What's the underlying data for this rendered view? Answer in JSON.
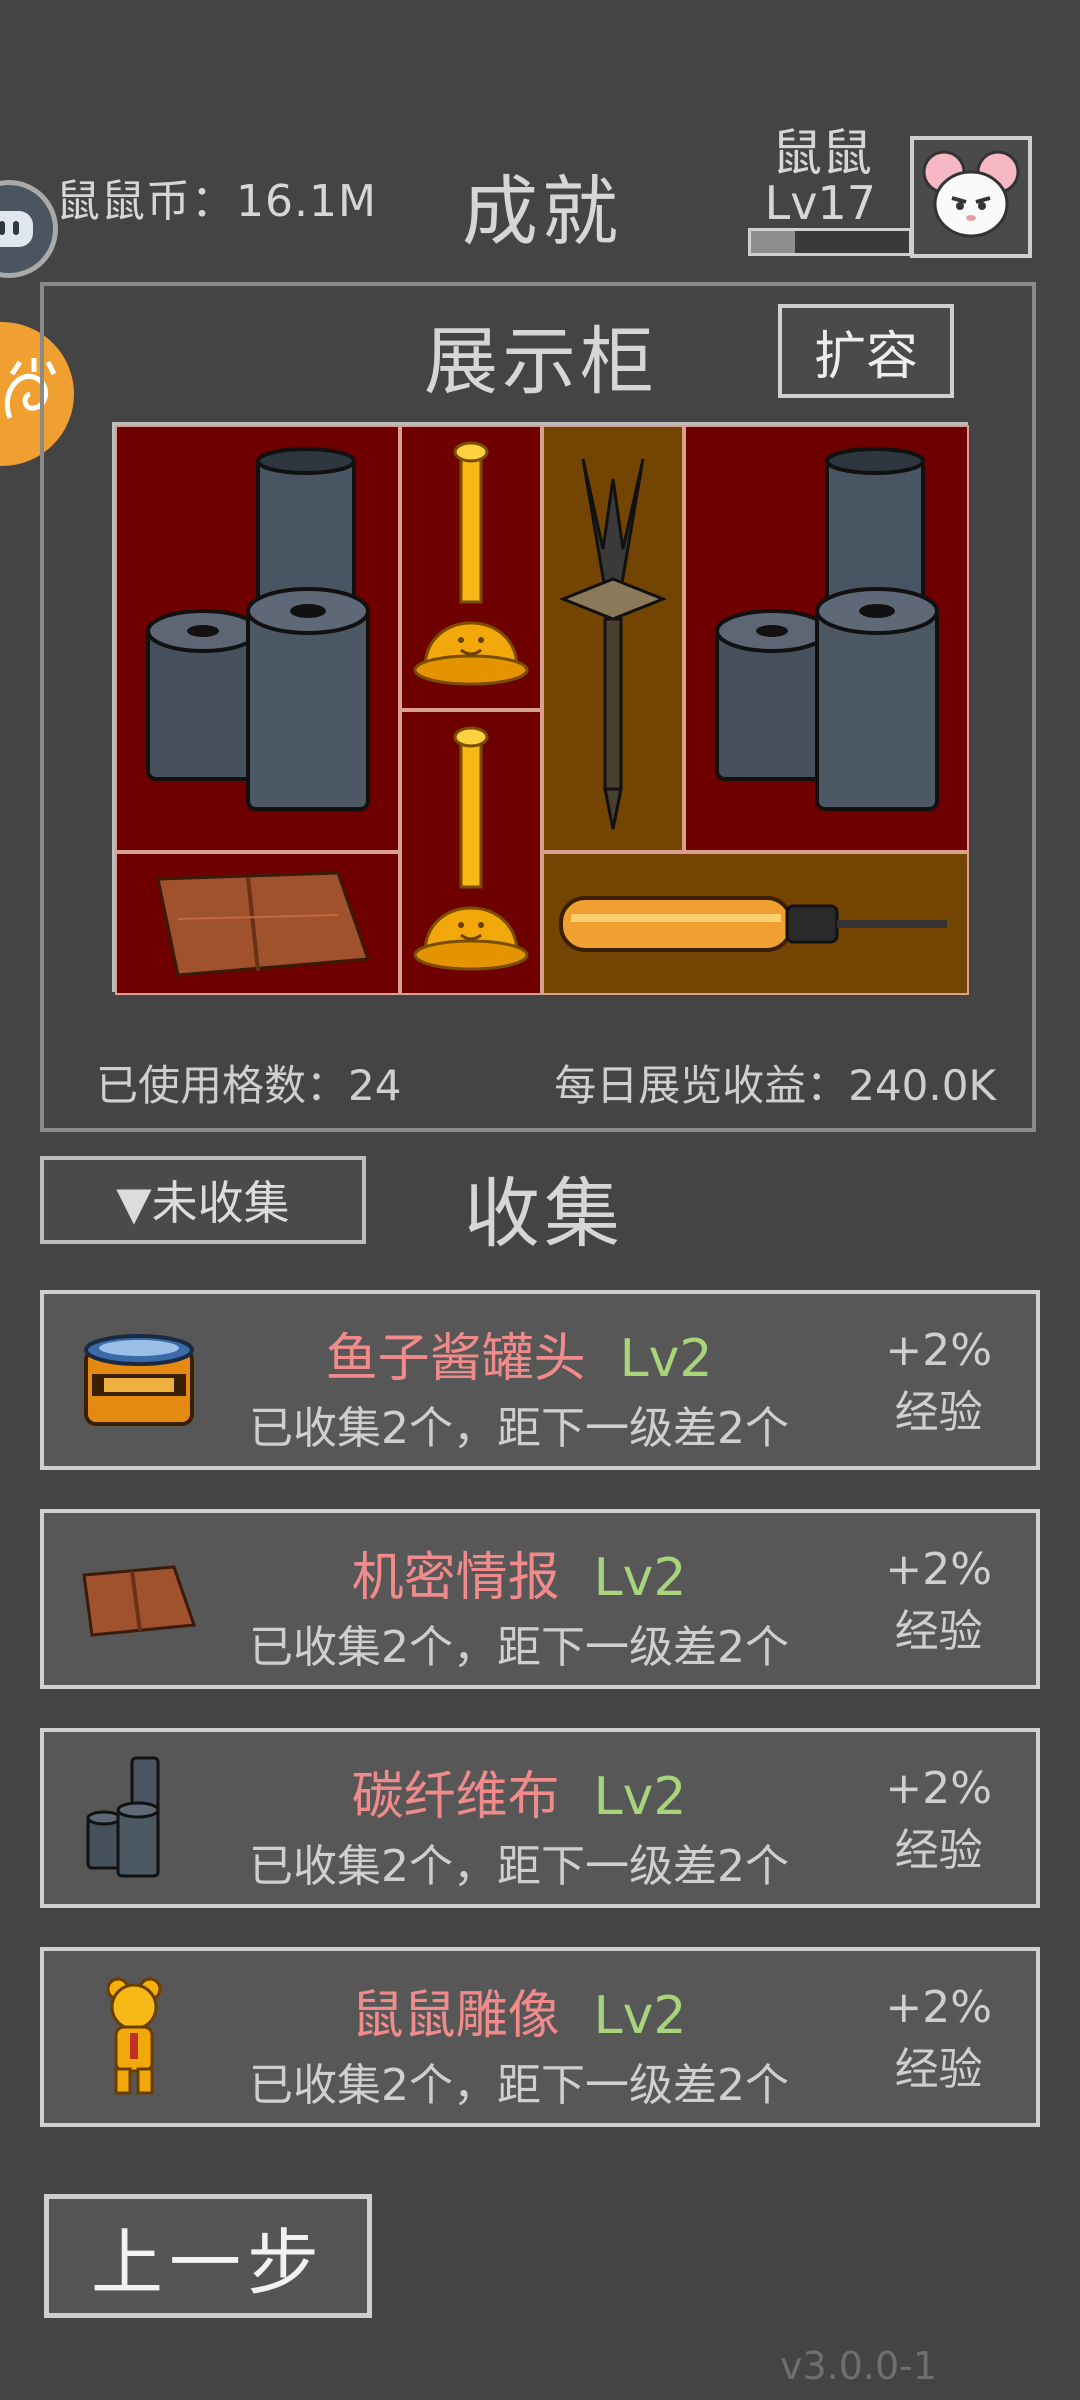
{
  "header": {
    "coins": "鼠鼠币：16.1M",
    "title": "成就",
    "user_name": "鼠鼠",
    "user_level": "Lv17",
    "xp_progress": 0.28
  },
  "cabinet": {
    "title": "展示柜",
    "expand_label": "扩容",
    "used_slots": "已使用格数：24",
    "daily_income": "每日展览收益：240.0K",
    "slots": [
      {
        "item": "carbon-fiber-rolls-icon"
      },
      {
        "item": "golden-trophy-icon"
      },
      {
        "item": "dagger-icon"
      },
      {
        "item": "carbon-fiber-rolls-icon"
      },
      {
        "item": "golden-trophy-icon"
      },
      {
        "item": "folder-icon"
      },
      {
        "item": "screwdriver-icon"
      }
    ]
  },
  "collection": {
    "filter_label": "▼未收集",
    "title": "收集",
    "items": [
      {
        "name": "鱼子酱罐头",
        "level": "Lv2",
        "desc": "已收集2个，距下一级差2个",
        "bonus": "+2%",
        "bonus_type": "经验",
        "icon": "caviar-can-icon"
      },
      {
        "name": "机密情报",
        "level": "Lv2",
        "desc": "已收集2个，距下一级差2个",
        "bonus": "+2%",
        "bonus_type": "经验",
        "icon": "folder-icon"
      },
      {
        "name": "碳纤维布",
        "level": "Lv2",
        "desc": "已收集2个，距下一级差2个",
        "bonus": "+2%",
        "bonus_type": "经验",
        "icon": "carbon-fiber-rolls-icon"
      },
      {
        "name": "鼠鼠雕像",
        "level": "Lv2",
        "desc": "已收集2个，距下一级差2个",
        "bonus": "+2%",
        "bonus_type": "经验",
        "icon": "mouse-statue-icon"
      }
    ]
  },
  "footer": {
    "back_label": "上一步",
    "version": "v3.0.0-1"
  },
  "colors": {
    "background": "#444444",
    "name": "#f18b8b",
    "level": "#a8d47a",
    "cabinet_red": "#6e0000",
    "cabinet_brown": "#744500"
  }
}
